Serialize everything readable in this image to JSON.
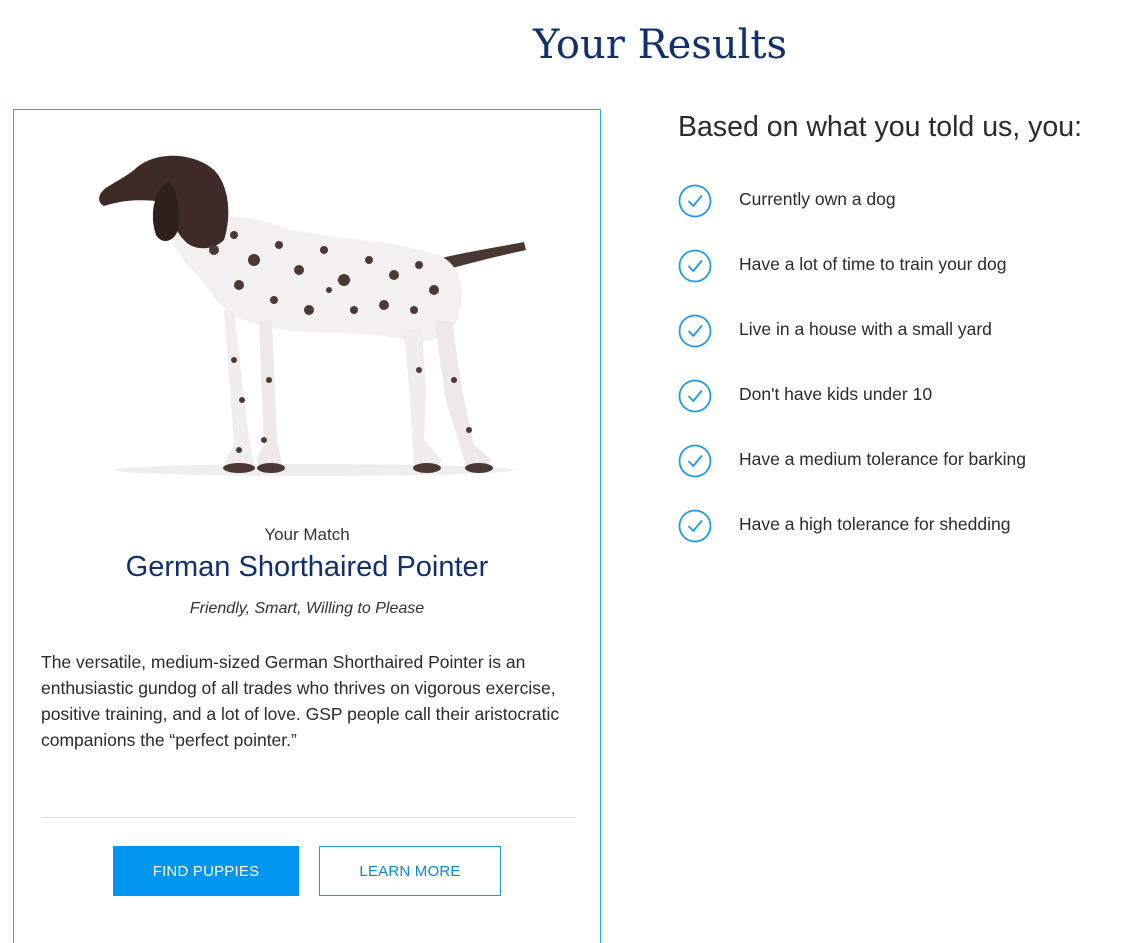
{
  "page": {
    "title": "Your Results"
  },
  "match": {
    "kicker": "Your Match",
    "breed": "German Shorthaired Pointer",
    "traits": "Friendly, Smart, Willing to Please",
    "description": "The versatile, medium-sized German Shorthaired Pointer is an enthusiastic gundog of all trades who thrives on vigorous exercise, positive training, and a lot of love. GSP people call their aristocratic companions the “perfect pointer.”",
    "image_icon": "dog-photo",
    "buttons": {
      "primary": "FIND PUPPIES",
      "secondary": "LEARN MORE"
    }
  },
  "criteria": {
    "heading": "Based on what you told us, you:",
    "items": [
      "Currently own a dog",
      "Have a lot of time to train your dog",
      "Live in a house with a small yard",
      "Don't have kids under 10",
      "Have a medium tolerance for barking",
      "Have a high tolerance for shedding"
    ]
  },
  "colors": {
    "title": "#12306f",
    "accent": "#0096f0",
    "card_border": "#29a6e4",
    "check": "#1e9be6"
  }
}
